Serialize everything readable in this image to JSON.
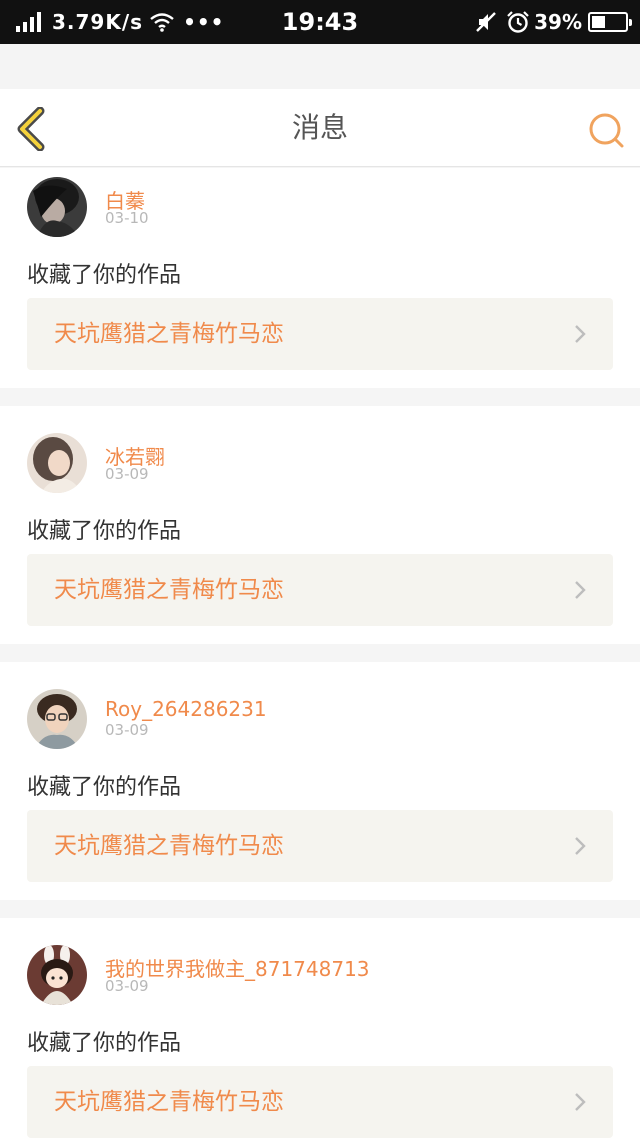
{
  "status_bar": {
    "speed": "3.79K/s",
    "dots": "•••",
    "time": "19:43",
    "battery": "39%",
    "battery_level": 0.39
  },
  "nav": {
    "title": "消息",
    "back_icon": "chevron-left-icon",
    "search_icon": "search-icon",
    "accent_color": "#f0a35e"
  },
  "messages": [
    {
      "user": "白蓁",
      "date": "03-10",
      "action": "收藏了你的作品",
      "work_title": "天坑鹰猎之青梅竹马恋",
      "avatar": "avatar-dark-hair"
    },
    {
      "user": "冰若翾",
      "date": "03-09",
      "action": "收藏了你的作品",
      "work_title": "天坑鹰猎之青梅竹马恋",
      "avatar": "avatar-girl-light"
    },
    {
      "user": "Roy_264286231",
      "date": "03-09",
      "action": "收藏了你的作品",
      "work_title": "天坑鹰猎之青梅竹马恋",
      "avatar": "avatar-boy-glasses"
    },
    {
      "user": "我的世界我做主_871748713",
      "date": "03-09",
      "action": "收藏了你的作品",
      "work_title": "天坑鹰猎之青梅竹马恋",
      "avatar": "avatar-cartoon-bunny"
    }
  ],
  "colors": {
    "username": "#f08a4b",
    "work_title": "#f08a4b",
    "date": "#b8b8b8",
    "work_bg": "#f5f4ef"
  }
}
